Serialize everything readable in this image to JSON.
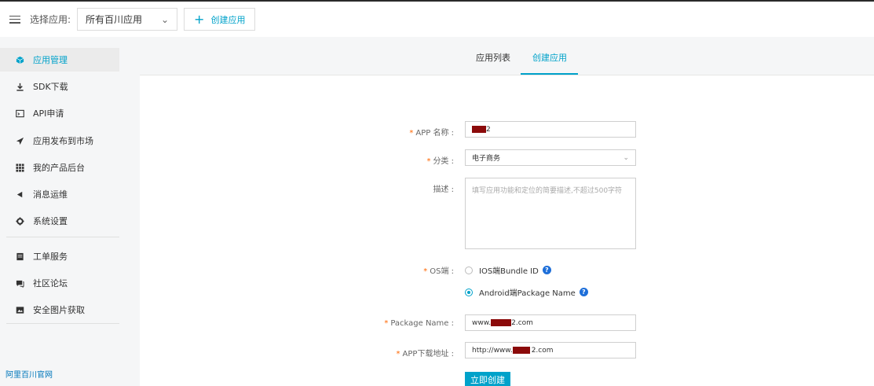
{
  "topbar": {
    "select_label": "选择应用:",
    "app_select_value": "所有百川应用",
    "create_label": "创建应用"
  },
  "sidebar": {
    "items": [
      {
        "label": "应用管理",
        "icon": "cube-icon"
      },
      {
        "label": "SDK下载",
        "icon": "download-icon"
      },
      {
        "label": "API申请",
        "icon": "terminal-icon"
      },
      {
        "label": "应用发布到市场",
        "icon": "send-icon"
      },
      {
        "label": "我的产品后台",
        "icon": "grid-icon"
      },
      {
        "label": "消息运维",
        "icon": "megaphone-icon"
      },
      {
        "label": "系统设置",
        "icon": "gear-icon"
      },
      {
        "label": "工单服务",
        "icon": "ticket-icon"
      },
      {
        "label": "社区论坛",
        "icon": "chat-icon"
      },
      {
        "label": "安全图片获取",
        "icon": "image-icon"
      }
    ],
    "footer_link": "阿里百川官网"
  },
  "tabs": {
    "list": "应用列表",
    "create": "创建应用"
  },
  "form": {
    "app_name_label": "APP 名称 :",
    "app_name_value_suffix": "2",
    "category_label": "分类 :",
    "category_value": "电子商务",
    "desc_label": "描述 :",
    "desc_placeholder": "填写应用功能和定位的简要描述,不超过500字符",
    "os_label": "OS端 :",
    "ios_option": "IOS端Bundle ID",
    "android_option": "Android端Package Name",
    "package_label": "Package Name :",
    "package_prefix": "www.",
    "package_suffix": "2.com",
    "download_label": "APP下载地址 :",
    "download_prefix": "http://www.",
    "download_suffix": "2.com",
    "submit_label": "立即创建"
  },
  "colors": {
    "accent": "#00a2ca",
    "required": "#ff6600",
    "redaction": "#8b0a0a"
  }
}
